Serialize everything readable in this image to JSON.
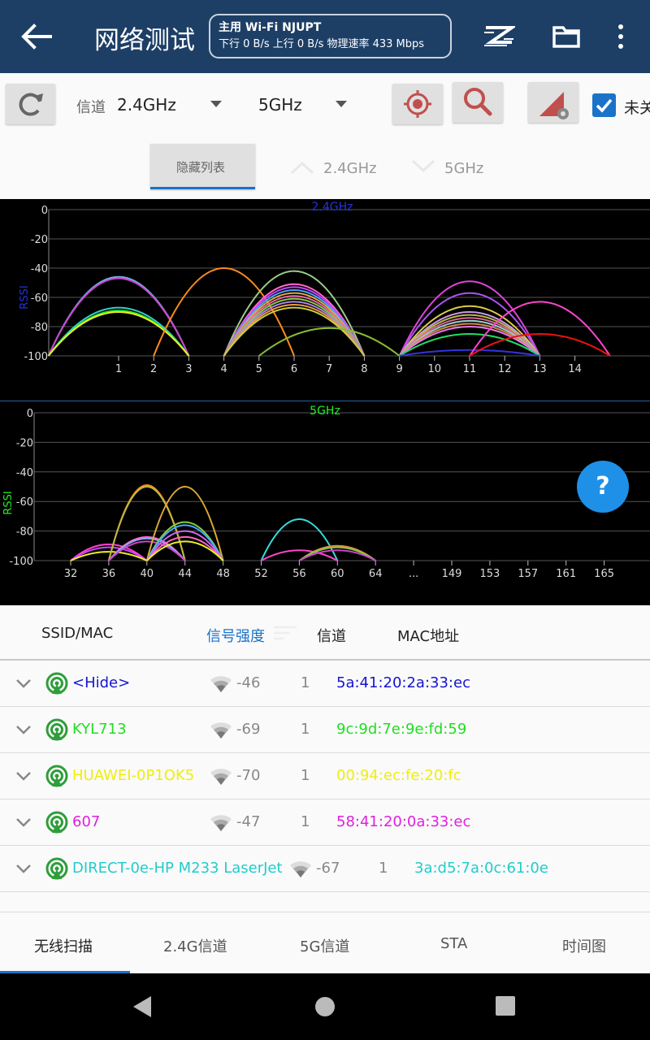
{
  "app": {
    "title": "网络测试",
    "wifi_line1": "主用 Wi-Fi NJUPT",
    "wifi_line2": "下行 0 B/s 上行 0 B/s 物理速率 433 Mbps"
  },
  "toolbar": {
    "channel_label": "信道",
    "band_24": "2.4GHz",
    "band_5": "5GHz",
    "checkbox_label": "未关",
    "hide_list": "隐藏列表",
    "toggle_24": "2.4GHz",
    "toggle_5": "5GHz"
  },
  "colors": {
    "topbar": "#1d3f66",
    "accent": "#1a73c8",
    "signal": "#2e9e3a"
  },
  "chart_data": [
    {
      "type": "line",
      "title": "2.4GHz",
      "ylabel": "RSSI",
      "ylim": [
        -100,
        0
      ],
      "y_ticks": [
        "0",
        "-20",
        "-40",
        "-60",
        "-80",
        "-100"
      ],
      "x_ticks": [
        "1",
        "2",
        "3",
        "4",
        "5",
        "6",
        "7",
        "8",
        "9",
        "10",
        "11",
        "12",
        "13",
        "14"
      ],
      "series": [
        {
          "center": 1,
          "rssi": -46,
          "width": 4,
          "color": "#6ab0e8"
        },
        {
          "center": 1,
          "rssi": -47,
          "width": 4,
          "color": "#cc44cc"
        },
        {
          "center": 1,
          "rssi": -67,
          "width": 4,
          "color": "#33cccc"
        },
        {
          "center": 1,
          "rssi": -69,
          "width": 4,
          "color": "#22ee22"
        },
        {
          "center": 1,
          "rssi": -70,
          "width": 4,
          "color": "#eeee22"
        },
        {
          "center": 4,
          "rssi": -40,
          "width": 4,
          "color": "#ff8c1a"
        },
        {
          "center": 6,
          "rssi": -42,
          "width": 4,
          "color": "#9acd8a"
        },
        {
          "center": 6,
          "rssi": -51,
          "width": 4,
          "color": "#ff66cc"
        },
        {
          "center": 6,
          "rssi": -53,
          "width": 4,
          "color": "#cc44ff"
        },
        {
          "center": 6,
          "rssi": -55,
          "width": 4,
          "color": "#44aaff"
        },
        {
          "center": 6,
          "rssi": -57,
          "width": 4,
          "color": "#ddaa44"
        },
        {
          "center": 6,
          "rssi": -59,
          "width": 4,
          "color": "#ee66aa"
        },
        {
          "center": 6,
          "rssi": -61,
          "width": 4,
          "color": "#88cc44"
        },
        {
          "center": 6,
          "rssi": -63,
          "width": 4,
          "color": "#aa88ee"
        },
        {
          "center": 6,
          "rssi": -65,
          "width": 4,
          "color": "#ee9944"
        },
        {
          "center": 6,
          "rssi": -67,
          "width": 4,
          "color": "#cccc44"
        },
        {
          "center": 7,
          "rssi": -81,
          "width": 4,
          "color": "#88bb33"
        },
        {
          "center": 11,
          "rssi": -49,
          "width": 4,
          "color": "#dd44dd"
        },
        {
          "center": 11,
          "rssi": -57,
          "width": 4,
          "color": "#aa55ee"
        },
        {
          "center": 11,
          "rssi": -66,
          "width": 4,
          "color": "#ddcc44"
        },
        {
          "center": 11,
          "rssi": -70,
          "width": 4,
          "color": "#cc99ee"
        },
        {
          "center": 11,
          "rssi": -72,
          "width": 4,
          "color": "#bbbb44"
        },
        {
          "center": 11,
          "rssi": -74,
          "width": 4,
          "color": "#dd6699"
        },
        {
          "center": 11,
          "rssi": -76,
          "width": 4,
          "color": "#99cccc"
        },
        {
          "center": 11,
          "rssi": -78,
          "width": 4,
          "color": "#cc8844"
        },
        {
          "center": 11,
          "rssi": -80,
          "width": 4,
          "color": "#ee77ee"
        },
        {
          "center": 11,
          "rssi": -85,
          "width": 4,
          "color": "#22dd66"
        },
        {
          "center": 11,
          "rssi": -96,
          "width": 4,
          "color": "#3333dd"
        },
        {
          "center": 13,
          "rssi": -63,
          "width": 4,
          "color": "#ff44cc"
        },
        {
          "center": 13,
          "rssi": -85,
          "width": 4,
          "color": "#ee1111"
        }
      ]
    },
    {
      "type": "line",
      "title": "5GHz",
      "ylabel": "RSSI",
      "ylim": [
        -100,
        0
      ],
      "y_ticks": [
        "0",
        "-20",
        "-40",
        "-60",
        "-80",
        "-100"
      ],
      "x_ticks": [
        "32",
        "36",
        "40",
        "44",
        "48",
        "52",
        "56",
        "60",
        "64",
        "...",
        "149",
        "153",
        "157",
        "161",
        "165"
      ],
      "series": [
        {
          "center": 2,
          "rssi": -89,
          "width": 2,
          "color": "#ff44cc"
        },
        {
          "center": 2,
          "rssi": -91,
          "width": 2,
          "color": "#cc44ff"
        },
        {
          "center": 2,
          "rssi": -94,
          "width": 2,
          "color": "#eeee22"
        },
        {
          "center": 3,
          "rssi": -49,
          "width": 2,
          "color": "#ff8c1a"
        },
        {
          "center": 3,
          "rssi": -50,
          "width": 2,
          "color": "#bbbb44"
        },
        {
          "center": 3,
          "rssi": -84,
          "width": 2,
          "color": "#ff66cc"
        },
        {
          "center": 3,
          "rssi": -85,
          "width": 2,
          "color": "#88aaee"
        },
        {
          "center": 3,
          "rssi": -87,
          "width": 2,
          "color": "#cc44cc"
        },
        {
          "center": 4,
          "rssi": -50,
          "width": 2,
          "color": "#ddaa33"
        },
        {
          "center": 4,
          "rssi": -74,
          "width": 2,
          "color": "#88cc44"
        },
        {
          "center": 4,
          "rssi": -76,
          "width": 2,
          "color": "#44aaff"
        },
        {
          "center": 4,
          "rssi": -80,
          "width": 2,
          "color": "#cc66ee"
        },
        {
          "center": 4,
          "rssi": -84,
          "width": 2,
          "color": "#ff66cc"
        },
        {
          "center": 4,
          "rssi": -87,
          "width": 2,
          "color": "#eeee22"
        },
        {
          "center": 7,
          "rssi": -72,
          "width": 2,
          "color": "#33dddd"
        },
        {
          "center": 7,
          "rssi": -93,
          "width": 2,
          "color": "#ff44cc"
        },
        {
          "center": 8,
          "rssi": -90,
          "width": 2,
          "color": "#dd8844"
        },
        {
          "center": 8,
          "rssi": -91,
          "width": 2,
          "color": "#88cc44"
        },
        {
          "center": 8,
          "rssi": -93,
          "width": 2,
          "color": "#cc44cc"
        }
      ]
    }
  ],
  "list": {
    "headers": {
      "ssid": "SSID/MAC",
      "signal": "信号强度",
      "channel": "信道",
      "mac": "MAC地址"
    },
    "rows": [
      {
        "ssid": "<Hide>",
        "rssi": "-46",
        "channel": "1",
        "mac": "5a:41:20:2a:33:ec",
        "color": "#1515d0"
      },
      {
        "ssid": "KYL713",
        "rssi": "-69",
        "channel": "1",
        "mac": "9c:9d:7e:9e:fd:59",
        "color": "#22dd22"
      },
      {
        "ssid": "HUAWEI-0P1OK5",
        "rssi": "-70",
        "channel": "1",
        "mac": "00:94:ec:fe:20:fc",
        "color": "#eeee10"
      },
      {
        "ssid": "607",
        "rssi": "-47",
        "channel": "1",
        "mac": "58:41:20:0a:33:ec",
        "color": "#e020e0"
      },
      {
        "ssid": "DIRECT-0e-HP M233 LaserJet",
        "rssi": "-67",
        "channel": "1",
        "mac": "3a:d5:7a:0c:61:0e",
        "color": "#22cccc"
      }
    ]
  },
  "tabs": [
    "无线扫描",
    "2.4G信道",
    "5G信道",
    "STA",
    "时间图"
  ]
}
